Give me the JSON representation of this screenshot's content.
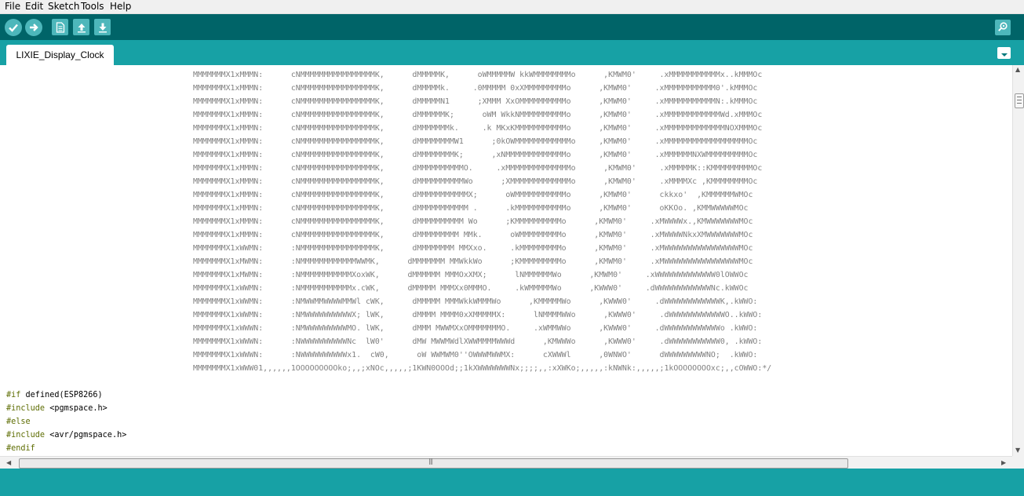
{
  "menu": [
    "File",
    "Edit",
    "Sketch",
    "Tools",
    "Help"
  ],
  "toolbar": {
    "icons": [
      "verify-check-icon",
      "upload-arrow-icon",
      "new-document-icon",
      "open-up-arrow-icon",
      "save-down-arrow-icon",
      "serial-monitor-magnifier-icon"
    ]
  },
  "tab": {
    "name": "LIXIE_Display_Clock"
  },
  "editor": {
    "ascii_art": [
      "MMMMMMMX1xMMMN:      cNMMMMMMMMMMMMMMMMK,      dMMMMMK,      oWMMMMMW kkWMMMMMMMMo      ,KMWM0'     .xMMMMMMMMMMMx..kMMMOc",
      "MMMMMMMX1xMMMN:      cNMMMMMMMMMMMMMMMMK,      dMMMMMk.     .0MMMMM 0xXMMMMMMMMMo      ,KMWM0'     .xMMMMMMMMMMM0'.kMMMOc",
      "MMMMMMMX1xMMMN:      cNMMMMMMMMMMMMMMMMK,      dMMMMMN1      ;XMMM XxOMMMMMMMMMMo      ,KMWM0'     .xMMMMMMMMMMMN:.kMMMOc",
      "MMMMMMMX1xMMMN:      cNMMMMMMMMMMMMMMMMK,      dMMMMMMK;      oWM WkkNMMMMMMMMMMo      ,KMWM0'     .xMMMMMMMMMMMMWd.xMMMOc",
      "MMMMMMMX1xMMMN:      cNMMMMMMMMMMMMMMMMK,      dMMMMMMMk.     .k MKxKMMMMMMMMMMMo      ,KMWM0'     .xMMMMMMMMMMMMMNOXMMMOc",
      "MMMMMMMX1xMMMN:      cNMMMMMMMMMMMMMMMMK,      dMMMMMMMMW1      ;0kOWMMMMMMMMMMMMo     ,KMWM0'     .xMMMMMMMMMMMMMMMMMMOc",
      "MMMMMMMX1xMMMN:      cNMMMMMMMMMMMMMMMMK,      dMMMMMMMMK;      ,xNMMMMMMMMMMMMMo      ,KMWM0'     .xMMMMMMNXWMMMMMMMMMOc",
      "MMMMMMMX1xMMMN:      cNMMMMMMMMMMMMMMMMK,      dMMMMMMMMMMO.     .xMMMMMMMMMMMMMMo      ,KMWM0'     .xMMMMMK::KMMMMMMMMMOc",
      "MMMMMMMX1xMMMN:      cNMMMMMMMMMMMMMMMMK,      dMMMMMMMMMMWo      ;XMMMMMMMMMMMMMo      ,KMWM0'     .xMMMMXc ,KMMMMMMMMOc",
      "MMMMMMMX1xMMMN:      cNMMMMMMMMMMMMMMMMK,      dMMMMMMMMMMMX;      oWMMMMMMMMMMMo      ,KMWM0'      ckkxo'  ,KMMMMMMWMOc",
      "MMMMMMMX1xMMMN:      cNMMMMMMMMMMMMMMMMK,      dMMMMMMMMMMM .      .kMMMMMMMMMMMo      ,KMWM0'      oKKOo. ,KMMWWWWWMOc",
      "MMMMMMMX1xMMMN:      cNMMMMMMMMMMMMMMMMK,      dMMMMMMMMMM Wo      ;KMMMMMMMMMMo      ,KMWM0'     .xMWWWWx.,KMWWWWWWWMOc",
      "MMMMMMMX1xMMMN:      cNMMMMMMMMMMMMMMMMK,      dMMMMMMMMM MMk.      oWMMMMMMMMMo      ,KMWM0'     .xMWWWWNkxXMWWWWWWWMOc",
      "MMMMMMMX1xWWMN:      :NMMMMMMMMMMMMMMMMK,      dMMMMMMMM MMXxo.     .kMMMMMMMMMo      ,KMWM0'     .xMWWWWWWWWWWWWWWWWMOc",
      "MMMMMMMX1xMWMN:      :NMMMMMMMMMMMMWWMK,      dMMMMMMM MMWkkWo      ;KMMMMMMMMMo      ,KMWM0'     .xMWWWWWWWWWWWWWWWWMOc",
      "MMMMMMMX1xMWMN:      :NMMMMMMMMMMMXoxWK,      dMMMMMM MMMOxXMX;      lNMMMMMMWo      ,KMWM0'     .xWWWWWWWWWWWWW0lOWWOc",
      "MMMMMMMX1xWWMN:      :NMMMMMMMMMMMx.cWK,      dMMMMM MMMXx0MMMO.     .kWMMMMMWo      ,KWWW0'     .dWWWWWWWWWWWWNc.kWWOc",
      "MMMMMMMX1xWWMN:      :NMWWMMWWWWMMWl cWK,      dMMMMM MMMWkkWMMMWo      ,KMMMMMWo      ,KWWW0'     .dWWWWWWWWWWWWK,.kWWO:",
      "MMMMMMMX1xWWMN:      :NMWWWWWWWWWWX; lWK,      dMMMM MMMM0xXMMMMMX:      lNMMMMWWo      ,KWWW0'     .dWWWWWWWWWWWWO..kWWO:",
      "MMMMMMMX1xWWWN:      :NMWWWWWWWWWMO. lWK,      dMMM MWWMXxOMMMMMMMO.     .xWMMWWo      ,KWWW0'     .dWWWWWWWWWWWWo .kWWO:",
      "MMMMMMMX1xWWWN:      :NWWWWWWWWWWNc  lW0'      dMW MWWMWdlXWWMMMMWWWd      ,KMWWWo      ,KWWW0'     .dWWWWWWWWWWW0, .kWWO:",
      "MMMMMMMX1xWWWN:      :NWWWWWWWWWWx1.  cW0,      oW WWMWM0''OWWWMWWMX:      cXWWWl      ,0WNWO'      dWWWWWWWWWNO;  .kWWO:",
      "MMMMMMMX1xWWW01,,,,,,1OOOOOOOOOko;,,;xNOc,,,,,;1KWN0OOOd;;1kXWWWWWWWNx;;;;,,:xXWKo;,,,,,:kNWNk:,,,,,;1kOOOOOOOOxc;,,cOWWO:*/"
    ],
    "code_lines": [
      {
        "kw": "#if",
        "rest": " defined(ESP8266)"
      },
      {
        "kw": "#include",
        "rest": " <pgmspace.h>"
      },
      {
        "kw": "#else",
        "rest": ""
      },
      {
        "kw": "#include",
        "rest": " <avr/pgmspace.h>"
      },
      {
        "kw": "#endif",
        "rest": ""
      }
    ]
  },
  "scrollbars": {
    "up_arrow": "▲",
    "down_arrow": "▼",
    "left_arrow": "◀",
    "right_arrow": "▶",
    "grip": "|||"
  }
}
